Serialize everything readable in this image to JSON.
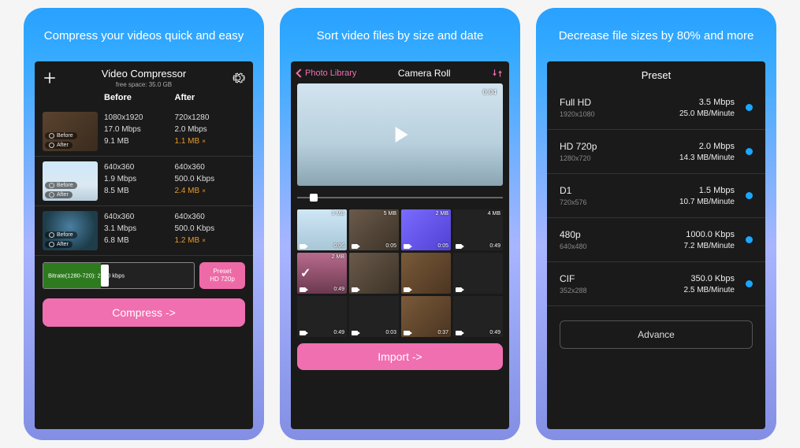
{
  "panels": {
    "p1": {
      "hero": "Compress your videos\nquick and easy",
      "title": "Video Compressor",
      "subtitle": "free space: 35.0 GB",
      "col_before": "Before",
      "col_after": "After",
      "rows": [
        {
          "badge_before": "Before",
          "badge_after": "After",
          "before_res": "1080x1920",
          "after_res": "720x1280",
          "before_rate": "17.0 Mbps",
          "after_rate": "2.0 Mbps",
          "before_size": "9.1 MB",
          "after_size": "1.1 MB",
          "after_mult": "×"
        },
        {
          "badge_before": "Before",
          "badge_after": "After",
          "before_res": "640x360",
          "after_res": "640x360",
          "before_rate": "1.9 Mbps",
          "after_rate": "500.0 Kbps",
          "before_size": "8.5 MB",
          "after_size": "2.4 MB",
          "after_mult": "×"
        },
        {
          "badge_before": "Before",
          "badge_after": "After",
          "before_res": "640x360",
          "after_res": "640x360",
          "before_rate": "3.1 Mbps",
          "after_rate": "500.0 Kbps",
          "before_size": "6.8 MB",
          "after_size": "1.2 MB",
          "after_mult": "×"
        }
      ],
      "bitrate_label": "Bitrate(1280-720): 2000 kbps",
      "preset_btn_line1": "Preset",
      "preset_btn_line2": "HD 720p",
      "compress_label": "Compress ->"
    },
    "p2": {
      "hero": "Sort video files by size\nand date",
      "back_label": "Photo Library",
      "title": "Camera Roll",
      "preview_duration": "0:04",
      "cells": [
        {
          "size": "3 MB",
          "dur": "0:06",
          "cls": "sky"
        },
        {
          "size": "5 MB",
          "dur": "0:05",
          "cls": ""
        },
        {
          "size": "2 MB",
          "dur": "0:05",
          "cls": "purple"
        },
        {
          "size": "4 MB",
          "dur": "0:49",
          "cls": "dark"
        },
        {
          "size": "2 MB",
          "dur": "0:49",
          "cls": "pink",
          "selected": true
        },
        {
          "size": "",
          "dur": "",
          "cls": ""
        },
        {
          "size": "",
          "dur": "",
          "cls": "brown"
        },
        {
          "size": "",
          "dur": "",
          "cls": "dark"
        },
        {
          "size": "",
          "dur": "0:49",
          "cls": "dark"
        },
        {
          "size": "",
          "dur": "0:03",
          "cls": "dark"
        },
        {
          "size": "",
          "dur": "0:37",
          "cls": "brown"
        },
        {
          "size": "",
          "dur": "0:49",
          "cls": "dark"
        }
      ],
      "import_label": "Import ->"
    },
    "p3": {
      "hero": "Decrease file sizes by 80%\nand more",
      "title": "Preset",
      "presets": [
        {
          "name": "Full HD",
          "dim": "1920x1080",
          "rate": "3.5 Mbps",
          "permin": "25.0 MB/Minute"
        },
        {
          "name": "HD 720p",
          "dim": "1280x720",
          "rate": "2.0 Mbps",
          "permin": "14.3 MB/Minute"
        },
        {
          "name": "D1",
          "dim": "720x576",
          "rate": "1.5 Mbps",
          "permin": "10.7 MB/Minute"
        },
        {
          "name": "480p",
          "dim": "640x480",
          "rate": "1000.0 Kbps",
          "permin": "7.2 MB/Minute"
        },
        {
          "name": "CIF",
          "dim": "352x288",
          "rate": "350.0 Kbps",
          "permin": "2.5 MB/Minute"
        }
      ],
      "advance_label": "Advance"
    }
  }
}
